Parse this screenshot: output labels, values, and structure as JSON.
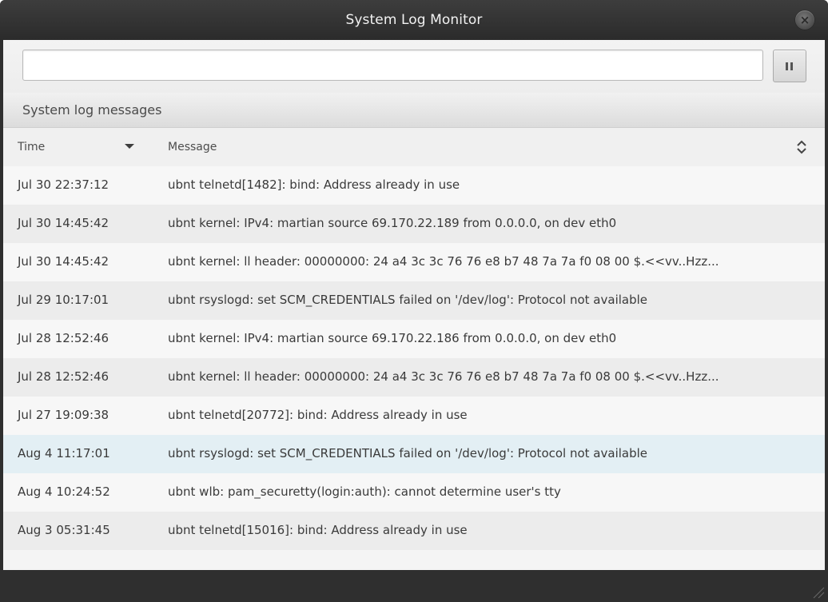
{
  "window": {
    "title": "System Log Monitor",
    "close_glyph": "×"
  },
  "toolbar": {
    "search_value": "",
    "search_placeholder": "",
    "pause_icon": "pause-icon"
  },
  "section": {
    "title": "System log messages"
  },
  "table": {
    "columns": [
      "Time",
      "Message"
    ],
    "sort_column": "Time",
    "sort_direction": "descending",
    "selected_row": 7,
    "rows": [
      {
        "time": "Jul 30 22:37:12",
        "message": "ubnt telnetd[1482]: bind: Address already in use"
      },
      {
        "time": "Jul 30 14:45:42",
        "message": "ubnt kernel: IPv4: martian source 69.170.22.189 from 0.0.0.0, on dev eth0"
      },
      {
        "time": "Jul 30 14:45:42",
        "message": "ubnt kernel: ll header: 00000000: 24 a4 3c 3c 76 76 e8 b7 48 7a 7a f0 08 00 $.<<vv..Hzz..."
      },
      {
        "time": "Jul 29 10:17:01",
        "message": "ubnt rsyslogd: set SCM_CREDENTIALS failed on '/dev/log': Protocol not available"
      },
      {
        "time": "Jul 28 12:52:46",
        "message": "ubnt kernel: IPv4: martian source 69.170.22.186 from 0.0.0.0, on dev eth0"
      },
      {
        "time": "Jul 28 12:52:46",
        "message": "ubnt kernel: ll header: 00000000: 24 a4 3c 3c 76 76 e8 b7 48 7a 7a f0 08 00 $.<<vv..Hzz..."
      },
      {
        "time": "Jul 27 19:09:38",
        "message": "ubnt telnetd[20772]: bind: Address already in use"
      },
      {
        "time": "Aug 4 11:17:01",
        "message": "ubnt rsyslogd: set SCM_CREDENTIALS failed on '/dev/log': Protocol not available"
      },
      {
        "time": "Aug 4 10:24:52",
        "message": "ubnt wlb: pam_securetty(login:auth): cannot determine user's tty"
      },
      {
        "time": "Aug 3 05:31:45",
        "message": "ubnt telnetd[15016]: bind: Address already in use"
      }
    ]
  },
  "colors": {
    "titlebar": "#2f2f2f",
    "selected_row": "#e3eff4",
    "row_odd": "#f7f7f7",
    "row_even": "#ececec"
  }
}
